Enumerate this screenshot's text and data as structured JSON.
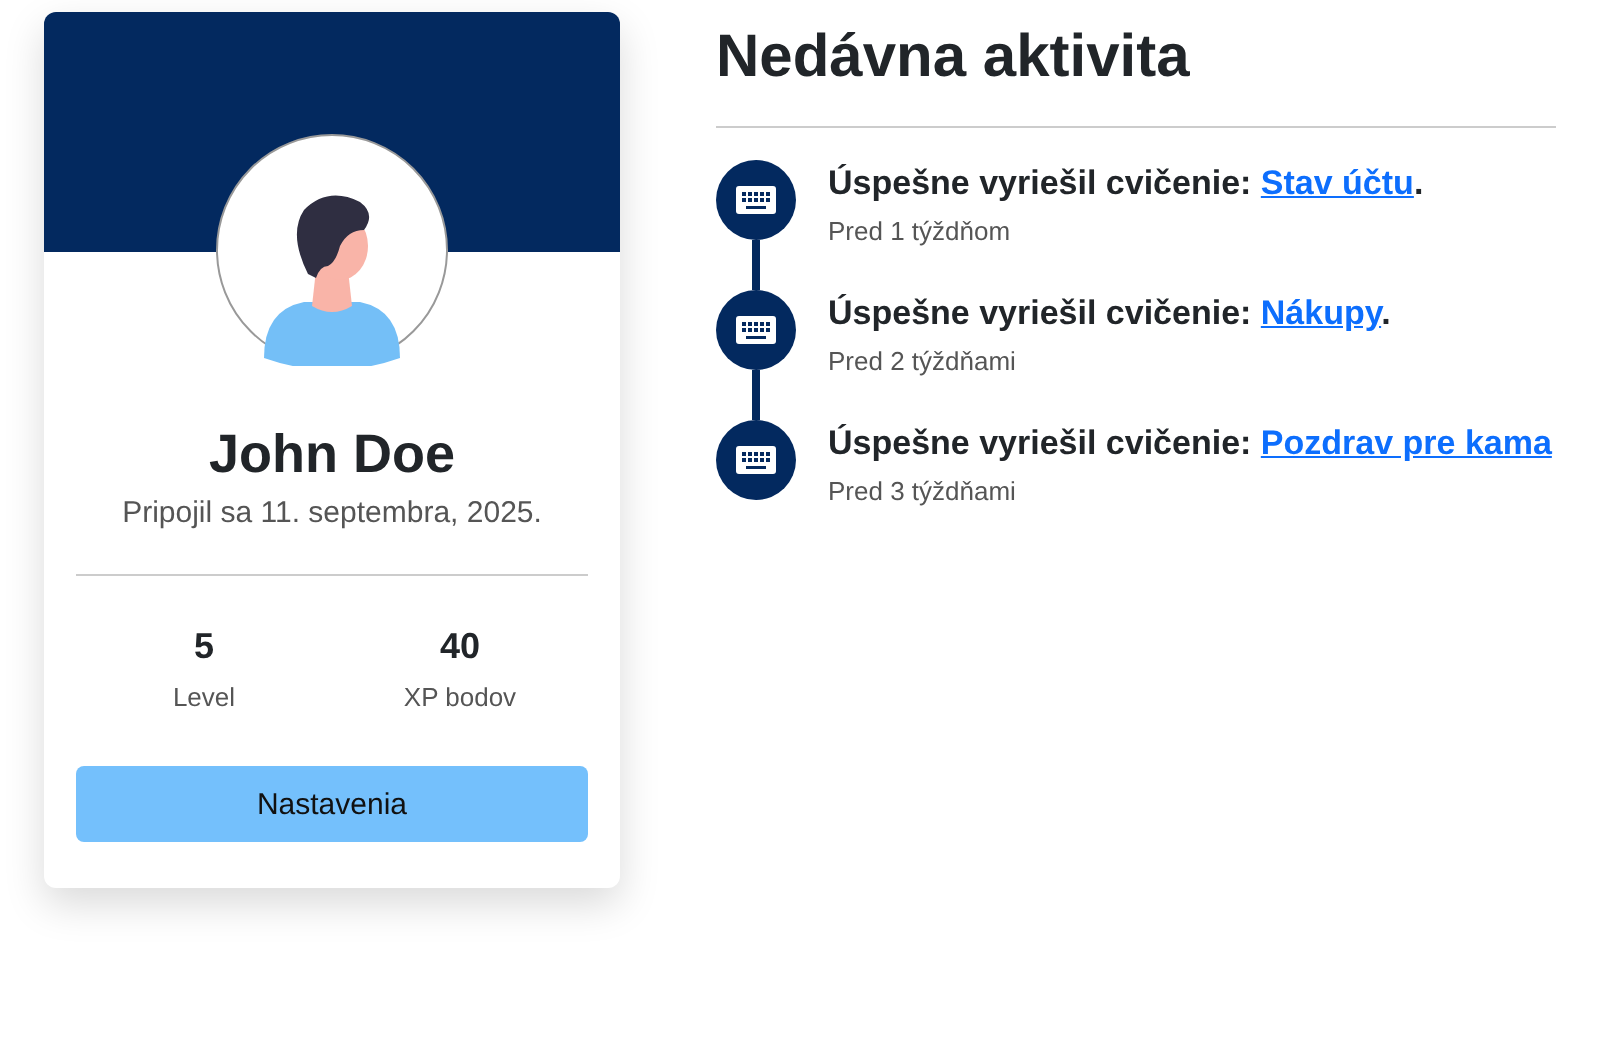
{
  "profile": {
    "name": "John Doe",
    "joined": "Pripojil sa 11. septembra, 2025.",
    "stats": [
      {
        "value": "5",
        "label": "Level"
      },
      {
        "value": "40",
        "label": "XP bodov"
      }
    ],
    "button": "Nastavenia"
  },
  "activity": {
    "title": "Nedávna aktivita",
    "items": [
      {
        "text": "Úspešne vyriešil cvičenie: ",
        "link": "Stav účtu",
        "suffix": ".",
        "time": "Pred 1 týždňom"
      },
      {
        "text": "Úspešne vyriešil cvičenie: ",
        "link": "Nákupy",
        "suffix": ".",
        "time": "Pred 2 týždňami"
      },
      {
        "text": "Úspešne vyriešil cvičenie: ",
        "link": "Pozdrav pre kama",
        "time": "Pred 3 týždňami"
      }
    ]
  }
}
